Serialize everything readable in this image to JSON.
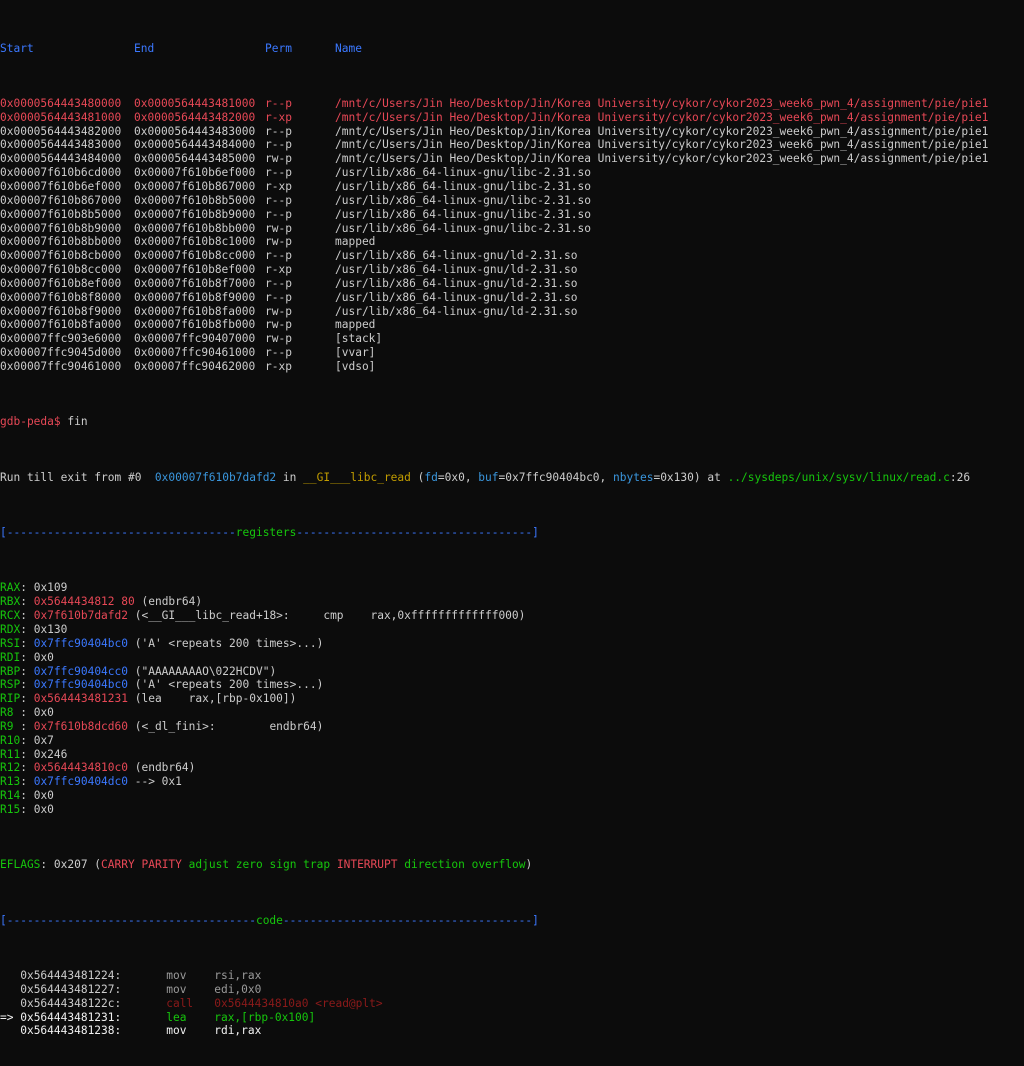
{
  "vmmap": {
    "headers": {
      "start": "Start",
      "end": "End",
      "perm": "Perm",
      "name": "Name"
    },
    "rows": [
      {
        "start": "0x0000564443480000",
        "end": "0x0000564443481000",
        "perm": "r--p",
        "name": "/mnt/c/Users/Jin Heo/Desktop/Jin/Korea University/cykor/cykor2023_week6_pwn_4/assignment/pie/pie1",
        "color": "#e74856"
      },
      {
        "start": "0x0000564443481000",
        "end": "0x0000564443482000",
        "perm": "r-xp",
        "name": "/mnt/c/Users/Jin Heo/Desktop/Jin/Korea University/cykor/cykor2023_week6_pwn_4/assignment/pie/pie1",
        "color": "#e74856"
      },
      {
        "start": "0x0000564443482000",
        "end": "0x0000564443483000",
        "perm": "r--p",
        "name": "/mnt/c/Users/Jin Heo/Desktop/Jin/Korea University/cykor/cykor2023_week6_pwn_4/assignment/pie/pie1",
        "color": "#cccccc"
      },
      {
        "start": "0x0000564443483000",
        "end": "0x0000564443484000",
        "perm": "r--p",
        "name": "/mnt/c/Users/Jin Heo/Desktop/Jin/Korea University/cykor/cykor2023_week6_pwn_4/assignment/pie/pie1",
        "color": "#cccccc"
      },
      {
        "start": "0x0000564443484000",
        "end": "0x0000564443485000",
        "perm": "rw-p",
        "name": "/mnt/c/Users/Jin Heo/Desktop/Jin/Korea University/cykor/cykor2023_week6_pwn_4/assignment/pie/pie1",
        "color": "#cccccc"
      },
      {
        "start": "0x00007f610b6cd000",
        "end": "0x00007f610b6ef000",
        "perm": "r--p",
        "name": "/usr/lib/x86_64-linux-gnu/libc-2.31.so",
        "color": "#cccccc"
      },
      {
        "start": "0x00007f610b6ef000",
        "end": "0x00007f610b867000",
        "perm": "r-xp",
        "name": "/usr/lib/x86_64-linux-gnu/libc-2.31.so",
        "color": "#cccccc"
      },
      {
        "start": "0x00007f610b867000",
        "end": "0x00007f610b8b5000",
        "perm": "r--p",
        "name": "/usr/lib/x86_64-linux-gnu/libc-2.31.so",
        "color": "#cccccc"
      },
      {
        "start": "0x00007f610b8b5000",
        "end": "0x00007f610b8b9000",
        "perm": "r--p",
        "name": "/usr/lib/x86_64-linux-gnu/libc-2.31.so",
        "color": "#cccccc"
      },
      {
        "start": "0x00007f610b8b9000",
        "end": "0x00007f610b8bb000",
        "perm": "rw-p",
        "name": "/usr/lib/x86_64-linux-gnu/libc-2.31.so",
        "color": "#cccccc"
      },
      {
        "start": "0x00007f610b8bb000",
        "end": "0x00007f610b8c1000",
        "perm": "rw-p",
        "name": "mapped",
        "color": "#cccccc"
      },
      {
        "start": "0x00007f610b8cb000",
        "end": "0x00007f610b8cc000",
        "perm": "r--p",
        "name": "/usr/lib/x86_64-linux-gnu/ld-2.31.so",
        "color": "#cccccc"
      },
      {
        "start": "0x00007f610b8cc000",
        "end": "0x00007f610b8ef000",
        "perm": "r-xp",
        "name": "/usr/lib/x86_64-linux-gnu/ld-2.31.so",
        "color": "#cccccc"
      },
      {
        "start": "0x00007f610b8ef000",
        "end": "0x00007f610b8f7000",
        "perm": "r--p",
        "name": "/usr/lib/x86_64-linux-gnu/ld-2.31.so",
        "color": "#cccccc"
      },
      {
        "start": "0x00007f610b8f8000",
        "end": "0x00007f610b8f9000",
        "perm": "r--p",
        "name": "/usr/lib/x86_64-linux-gnu/ld-2.31.so",
        "color": "#cccccc"
      },
      {
        "start": "0x00007f610b8f9000",
        "end": "0x00007f610b8fa000",
        "perm": "rw-p",
        "name": "/usr/lib/x86_64-linux-gnu/ld-2.31.so",
        "color": "#cccccc"
      },
      {
        "start": "0x00007f610b8fa000",
        "end": "0x00007f610b8fb000",
        "perm": "rw-p",
        "name": "mapped",
        "color": "#cccccc"
      },
      {
        "start": "0x00007ffc903e6000",
        "end": "0x00007ffc90407000",
        "perm": "rw-p",
        "name": "[stack]",
        "color": "#cccccc"
      },
      {
        "start": "0x00007ffc9045d000",
        "end": "0x00007ffc90461000",
        "perm": "r--p",
        "name": "[vvar]",
        "color": "#cccccc"
      },
      {
        "start": "0x00007ffc90461000",
        "end": "0x00007ffc90462000",
        "perm": "r-xp",
        "name": "[vdso]",
        "color": "#cccccc"
      }
    ]
  },
  "prompt": {
    "text": "gdb-peda$",
    "command": " fin"
  },
  "run_line": {
    "prefix": "Run till exit from #0  ",
    "addr": "0x00007f610b7dafd2",
    "in": " in ",
    "func": "__GI___libc_read",
    "p_open": " (",
    "arg1_name": "fd",
    "arg1_val": "=0x0, ",
    "arg2_name": "buf",
    "arg2_val": "=0x7ffc90404bc0, ",
    "arg3_name": "nbytes",
    "arg3_val": "=0x130",
    "at": ") at ",
    "file": "../sysdeps/unix/sysv/linux/read.c",
    "line_no": ":26"
  },
  "registers_banner": {
    "left": "[----------------------------------",
    "title": "registers",
    "right": "-----------------------------------]"
  },
  "registers": [
    {
      "name": "RAX",
      "sep": ": ",
      "value": "0x109",
      "value_color": "#cccccc",
      "rest": ""
    },
    {
      "name": "RBX",
      "sep": ": ",
      "value": "0x5644434812 80",
      "value_color": "#e74856",
      "rest": " (endbr64)"
    },
    {
      "name": "RCX",
      "sep": ": ",
      "value": "0x7f610b7dafd2",
      "value_color": "#e74856",
      "rest": " (<__GI___libc_read+18>:     cmp    rax,0xfffffffffffff000)"
    },
    {
      "name": "RDX",
      "sep": ": ",
      "value": "0x130",
      "value_color": "#cccccc",
      "rest": ""
    },
    {
      "name": "RSI",
      "sep": ": ",
      "value": "0x7ffc90404bc0",
      "value_color": "#3b78ff",
      "rest": " ('A' <repeats 200 times>...)"
    },
    {
      "name": "RDI",
      "sep": ": ",
      "value": "0x0",
      "value_color": "#cccccc",
      "rest": ""
    },
    {
      "name": "RBP",
      "sep": ": ",
      "value": "0x7ffc90404cc0",
      "value_color": "#3b78ff",
      "rest": " (\"AAAAAAAAO\\022HCDV\")"
    },
    {
      "name": "RSP",
      "sep": ": ",
      "value": "0x7ffc90404bc0",
      "value_color": "#3b78ff",
      "rest": " ('A' <repeats 200 times>...)"
    },
    {
      "name": "RIP",
      "sep": ": ",
      "value": "0x564443481231",
      "value_color": "#e74856",
      "rest": " (lea    rax,[rbp-0x100])"
    },
    {
      "name": "R8",
      "sep": " : ",
      "value": "0x0",
      "value_color": "#cccccc",
      "rest": ""
    },
    {
      "name": "R9",
      "sep": " : ",
      "value": "0x7f610b8dcd60",
      "value_color": "#e74856",
      "rest": " (<_dl_fini>:        endbr64)"
    },
    {
      "name": "R10",
      "sep": ": ",
      "value": "0x7",
      "value_color": "#cccccc",
      "rest": ""
    },
    {
      "name": "R11",
      "sep": ": ",
      "value": "0x246",
      "value_color": "#cccccc",
      "rest": ""
    },
    {
      "name": "R12",
      "sep": ": ",
      "value": "0x5644434810c0",
      "value_color": "#e74856",
      "rest": " (endbr64)"
    },
    {
      "name": "R13",
      "sep": ": ",
      "value": "0x7ffc90404dc0",
      "value_color": "#3b78ff",
      "rest": " --> 0x1"
    },
    {
      "name": "R14",
      "sep": ": ",
      "value": "0x0",
      "value_color": "#cccccc",
      "rest": ""
    },
    {
      "name": "R15",
      "sep": ": ",
      "value": "0x0",
      "value_color": "#cccccc",
      "rest": ""
    }
  ],
  "eflags": {
    "label": "EFLAGS",
    "value": ": 0x207 (",
    "carry": "CARRY",
    "sp1": " ",
    "parity": "PARITY",
    "sp2": " ",
    "lower": "adjust zero sign trap",
    "sp3": " ",
    "interrupt": "INTERRUPT",
    "sp4": " ",
    "lower2": "direction overflow",
    "close": ")"
  },
  "code_banner": {
    "left": "[-------------------------------------",
    "title": "code",
    "right": "-------------------------------------]"
  },
  "code": [
    {
      "marker": "   ",
      "addr": "0x564443481224:",
      "mn": "mov",
      "ops": "rsi,rax",
      "style": "dim"
    },
    {
      "marker": "   ",
      "addr": "0x564443481227:",
      "mn": "mov",
      "ops": "edi,0x0",
      "style": "dim"
    },
    {
      "marker": "   ",
      "addr": "0x56444348122c:",
      "mn": "call",
      "ops": "0x5644434810a0 <read@plt>",
      "style": "call"
    },
    {
      "marker": "=> ",
      "addr": "0x564443481231:",
      "mn": "lea",
      "ops": "rax,[rbp-0x100]",
      "style": "current"
    },
    {
      "marker": "   ",
      "addr": "0x564443481238:",
      "mn": "mov",
      "ops": "rdi,rax",
      "style": "next"
    }
  ]
}
